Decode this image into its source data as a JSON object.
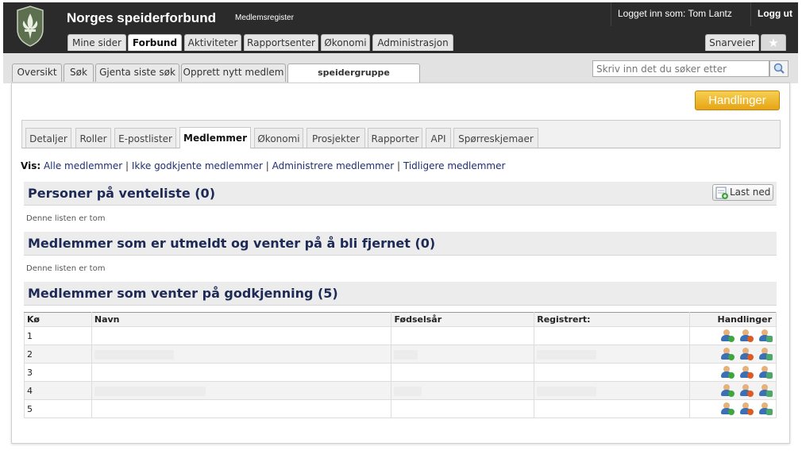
{
  "header": {
    "brand": "Norges speiderforbund",
    "sub": "Medlemsregister",
    "logged_in": "Logget inn som: Tom Lantz",
    "logout": "Logg ut"
  },
  "main_tabs": [
    {
      "label": "Mine sider"
    },
    {
      "label": "Forbund"
    },
    {
      "label": "Aktiviteter"
    },
    {
      "label": "Rapportsenter"
    },
    {
      "label": "Økonomi"
    },
    {
      "label": "Administrasjon"
    }
  ],
  "shortcuts": "Snarveier",
  "sub_tabs": [
    {
      "label": "Oversikt"
    },
    {
      "label": "Søk"
    },
    {
      "label": "Gjenta siste søk"
    },
    {
      "label": "Opprett nytt medlem"
    },
    {
      "label": "speidergruppe"
    }
  ],
  "search": {
    "placeholder": "Skriv inn det du søker etter"
  },
  "actions_button": "Handlinger",
  "detail_tabs": [
    {
      "label": "Detaljer"
    },
    {
      "label": "Roller"
    },
    {
      "label": "E-postlister"
    },
    {
      "label": "Medlemmer"
    },
    {
      "label": "Økonomi"
    },
    {
      "label": "Prosjekter"
    },
    {
      "label": "Rapporter"
    },
    {
      "label": "API"
    },
    {
      "label": "Spørreskjemaer"
    }
  ],
  "vis": {
    "label": "Vis:",
    "links": [
      "Alle medlemmer",
      "Ikke godkjente medlemmer",
      "Administrere medlemmer",
      "Tidligere medlemmer"
    ],
    "sep": "|"
  },
  "sections": {
    "waiting": {
      "title": "Personer på venteliste (0)",
      "empty": "Denne listen er tom",
      "download": "Last ned"
    },
    "removed": {
      "title": "Medlemmer som er utmeldt og venter på å bli fjernet (0)",
      "empty": "Denne listen er tom"
    },
    "approval": {
      "title": "Medlemmer som venter på godkjenning (5)"
    }
  },
  "table": {
    "headers": [
      "Kø",
      "Navn",
      "Fødselsår",
      "Registrert:",
      "Handlinger"
    ],
    "rows": [
      {
        "ko": "1"
      },
      {
        "ko": "2"
      },
      {
        "ko": "3"
      },
      {
        "ko": "4"
      },
      {
        "ko": "5"
      }
    ]
  },
  "colors": {
    "header_bg": "#2b2b2b",
    "accent_orange": "#e7a413",
    "title_blue": "#1d2a55",
    "approve": "#3da63d",
    "reject": "#e05a1f"
  }
}
